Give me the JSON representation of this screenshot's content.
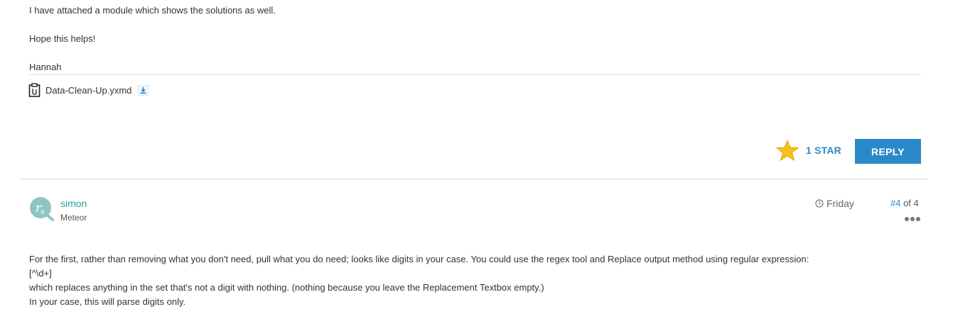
{
  "prev_post": {
    "paragraphs": [
      "I have attached a module which shows the solutions as well.",
      "Hope this helps!",
      "Hannah"
    ],
    "attachment": {
      "filename": "Data-Clean-Up.yxmd",
      "icon": "clipboard-icon",
      "download_icon": "download-icon"
    },
    "stars_label": "1 STAR",
    "reply_label": "REPLY"
  },
  "post": {
    "author": "simon",
    "rank": "Meteor",
    "date": "Friday",
    "post_number": {
      "hash": "#4",
      "rest": " of 4"
    },
    "body": [
      "For the first, rather than removing what you don't need, pull what you do need; looks like digits in your case. You could use the regex tool and Replace output method using regular expression:",
      "[^\\d+]",
      "which replaces anything in the set that's not a digit with nothing. (nothing because you leave the Replacement Textbox empty.)",
      "In your case, this will parse digits only."
    ]
  },
  "colors": {
    "accent": "#2a8ac9",
    "username": "#2aa0a0",
    "star": "#f6c418"
  }
}
